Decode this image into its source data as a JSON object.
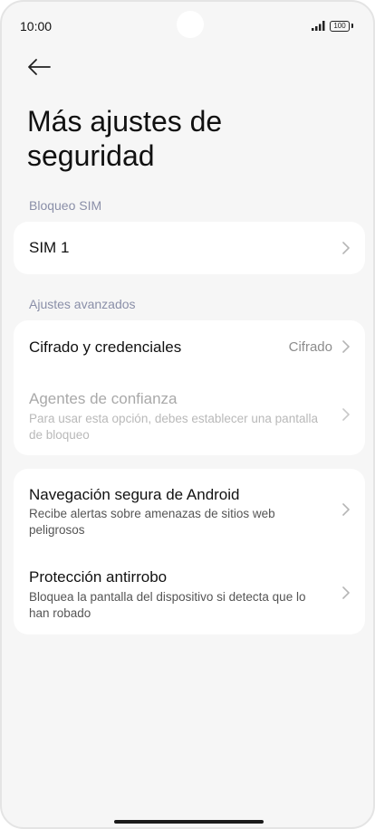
{
  "status": {
    "time": "10:00",
    "battery": "100"
  },
  "header": {
    "title": "Más ajustes de seguridad"
  },
  "sections": {
    "sim_lock": "Bloqueo SIM",
    "advanced": "Ajustes avanzados"
  },
  "sim": {
    "label": "SIM 1"
  },
  "advanced": {
    "encryption": {
      "label": "Cifrado y credenciales",
      "value": "Cifrado"
    },
    "trust_agents": {
      "label": "Agentes de confianza",
      "subtitle": "Para usar esta opción, debes establecer una pantalla de bloqueo"
    }
  },
  "safety": {
    "safe_browsing": {
      "label": "Navegación segura de Android",
      "subtitle": "Recibe alertas sobre amenazas de sitios web peligrosos"
    },
    "theft": {
      "label": "Protección antirrobo",
      "subtitle": "Bloquea la pantalla del dispositivo si detecta que lo han robado"
    }
  },
  "icons": {
    "back": "arrow-left-icon",
    "chevron": "chevron-right-icon"
  }
}
